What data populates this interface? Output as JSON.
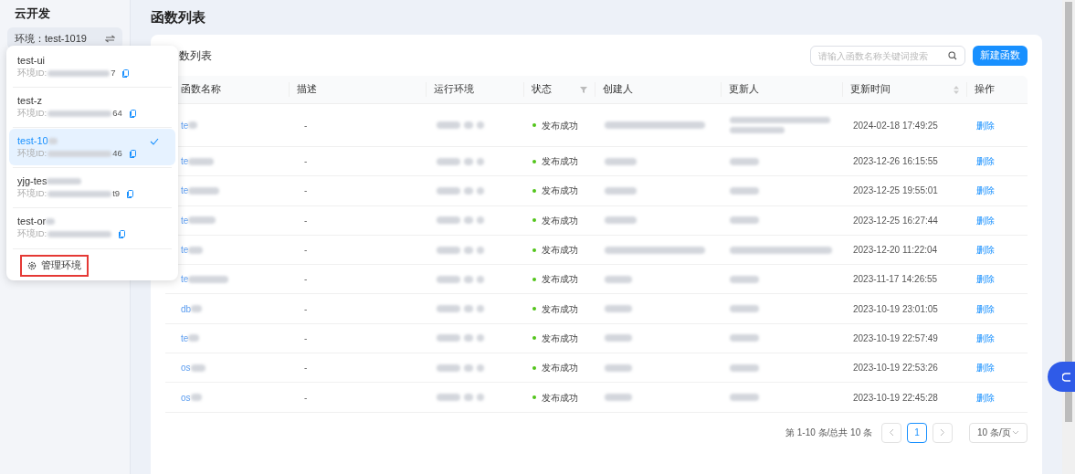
{
  "sidebar": {
    "title": "云开发",
    "env_selector": {
      "label": "环境：test-1019"
    }
  },
  "env_menu": {
    "items": [
      {
        "name": "test-ui",
        "id_label": "环境ID:",
        "id_suffix": "7",
        "selected": false
      },
      {
        "name": "test-z",
        "id_label": "环境ID:",
        "id_suffix": "64",
        "selected": false
      },
      {
        "name": "test-10",
        "id_label": "环境ID:",
        "id_suffix": "46",
        "selected": true
      },
      {
        "name": "yjg-tes",
        "id_label": "环境ID:",
        "id_suffix": "t9",
        "selected": false
      },
      {
        "name": "test-or",
        "id_label": "环境ID:",
        "selected": false
      }
    ],
    "manage_label": "管理环境"
  },
  "page_title": "函数列表",
  "card": {
    "title": "数列表",
    "search_placeholder": "请输入函数名称关键词搜索",
    "new_button": "新建函数"
  },
  "table": {
    "columns": [
      {
        "label": "函数名称"
      },
      {
        "label": "描述"
      },
      {
        "label": "运行环境"
      },
      {
        "label": "状态",
        "filter": true
      },
      {
        "label": "创建人"
      },
      {
        "label": "更新人"
      },
      {
        "label": "更新时间",
        "sortable": true
      },
      {
        "label": "操作"
      }
    ],
    "rows": [
      {
        "name": "te",
        "description": "-",
        "status": "发布成功",
        "updated": "2024-02-18 17:49:25",
        "action": "删除",
        "tall": true
      },
      {
        "name": "te",
        "description": "-",
        "status": "发布成功",
        "updated": "2023-12-26 16:15:55",
        "action": "删除",
        "tall": false
      },
      {
        "name": "te",
        "description": "-",
        "status": "发布成功",
        "updated": "2023-12-25 19:55:01",
        "action": "删除",
        "tall": false
      },
      {
        "name": "te",
        "description": "-",
        "status": "发布成功",
        "updated": "2023-12-25 16:27:44",
        "action": "删除",
        "tall": false
      },
      {
        "name": "te",
        "description": "-",
        "status": "发布成功",
        "updated": "2023-12-20 11:22:04",
        "action": "删除",
        "tall": false
      },
      {
        "name": "te",
        "description": "-",
        "status": "发布成功",
        "updated": "2023-11-17 14:26:55",
        "action": "删除",
        "tall": false
      },
      {
        "name": "db",
        "description": "-",
        "status": "发布成功",
        "updated": "2023-10-19 23:01:05",
        "action": "删除",
        "tall": false
      },
      {
        "name": "te",
        "description": "-",
        "status": "发布成功",
        "updated": "2023-10-19 22:57:49",
        "action": "删除",
        "tall": false
      },
      {
        "name": "os",
        "description": "-",
        "status": "发布成功",
        "updated": "2023-10-19 22:53:26",
        "action": "删除",
        "tall": false
      },
      {
        "name": "os",
        "description": "-",
        "status": "发布成功",
        "updated": "2023-10-19 22:45:28",
        "action": "删除",
        "tall": false
      }
    ]
  },
  "pagination": {
    "summary": "第 1-10 条/总共 10 条",
    "pages": [
      {
        "label": "1",
        "selected": true
      }
    ],
    "page_size": "10 条/页"
  }
}
